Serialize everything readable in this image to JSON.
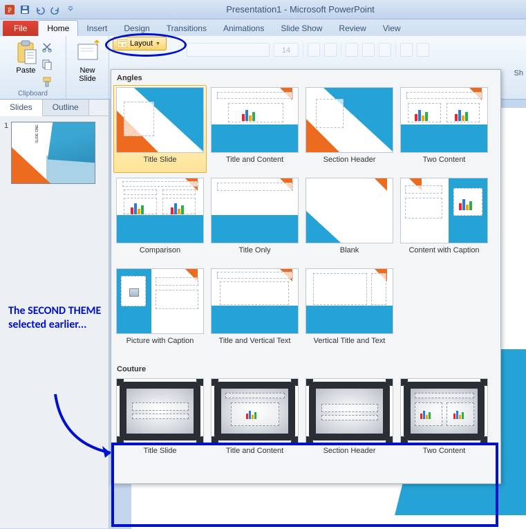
{
  "title": "Presentation1 - Microsoft PowerPoint",
  "tabs": {
    "file": "File",
    "home": "Home",
    "insert": "Insert",
    "design": "Design",
    "transitions": "Transitions",
    "animations": "Animations",
    "slideshow": "Slide Show",
    "review": "Review",
    "view": "View"
  },
  "ribbon": {
    "clipboard": "Clipboard",
    "paste": "Paste",
    "newslide": "New\nSlide",
    "layout": "Layout",
    "sh": "Sh",
    "fontnum": "14"
  },
  "pane": {
    "slides": "Slides",
    "outline": "Outline",
    "slide1_num": "1"
  },
  "gallery": {
    "section1": "Angles",
    "section2": "Couture",
    "angles": [
      "Title Slide",
      "Title and Content",
      "Section Header",
      "Two Content",
      "Comparison",
      "Title Only",
      "Blank",
      "Content with Caption",
      "Picture with Caption",
      "Title and Vertical Text",
      "Vertical Title and Text"
    ],
    "couture": [
      "Title Slide",
      "Title and Content",
      "Section Header",
      "Two Content"
    ]
  },
  "callout": "The SECOND THEME selected earlier..."
}
